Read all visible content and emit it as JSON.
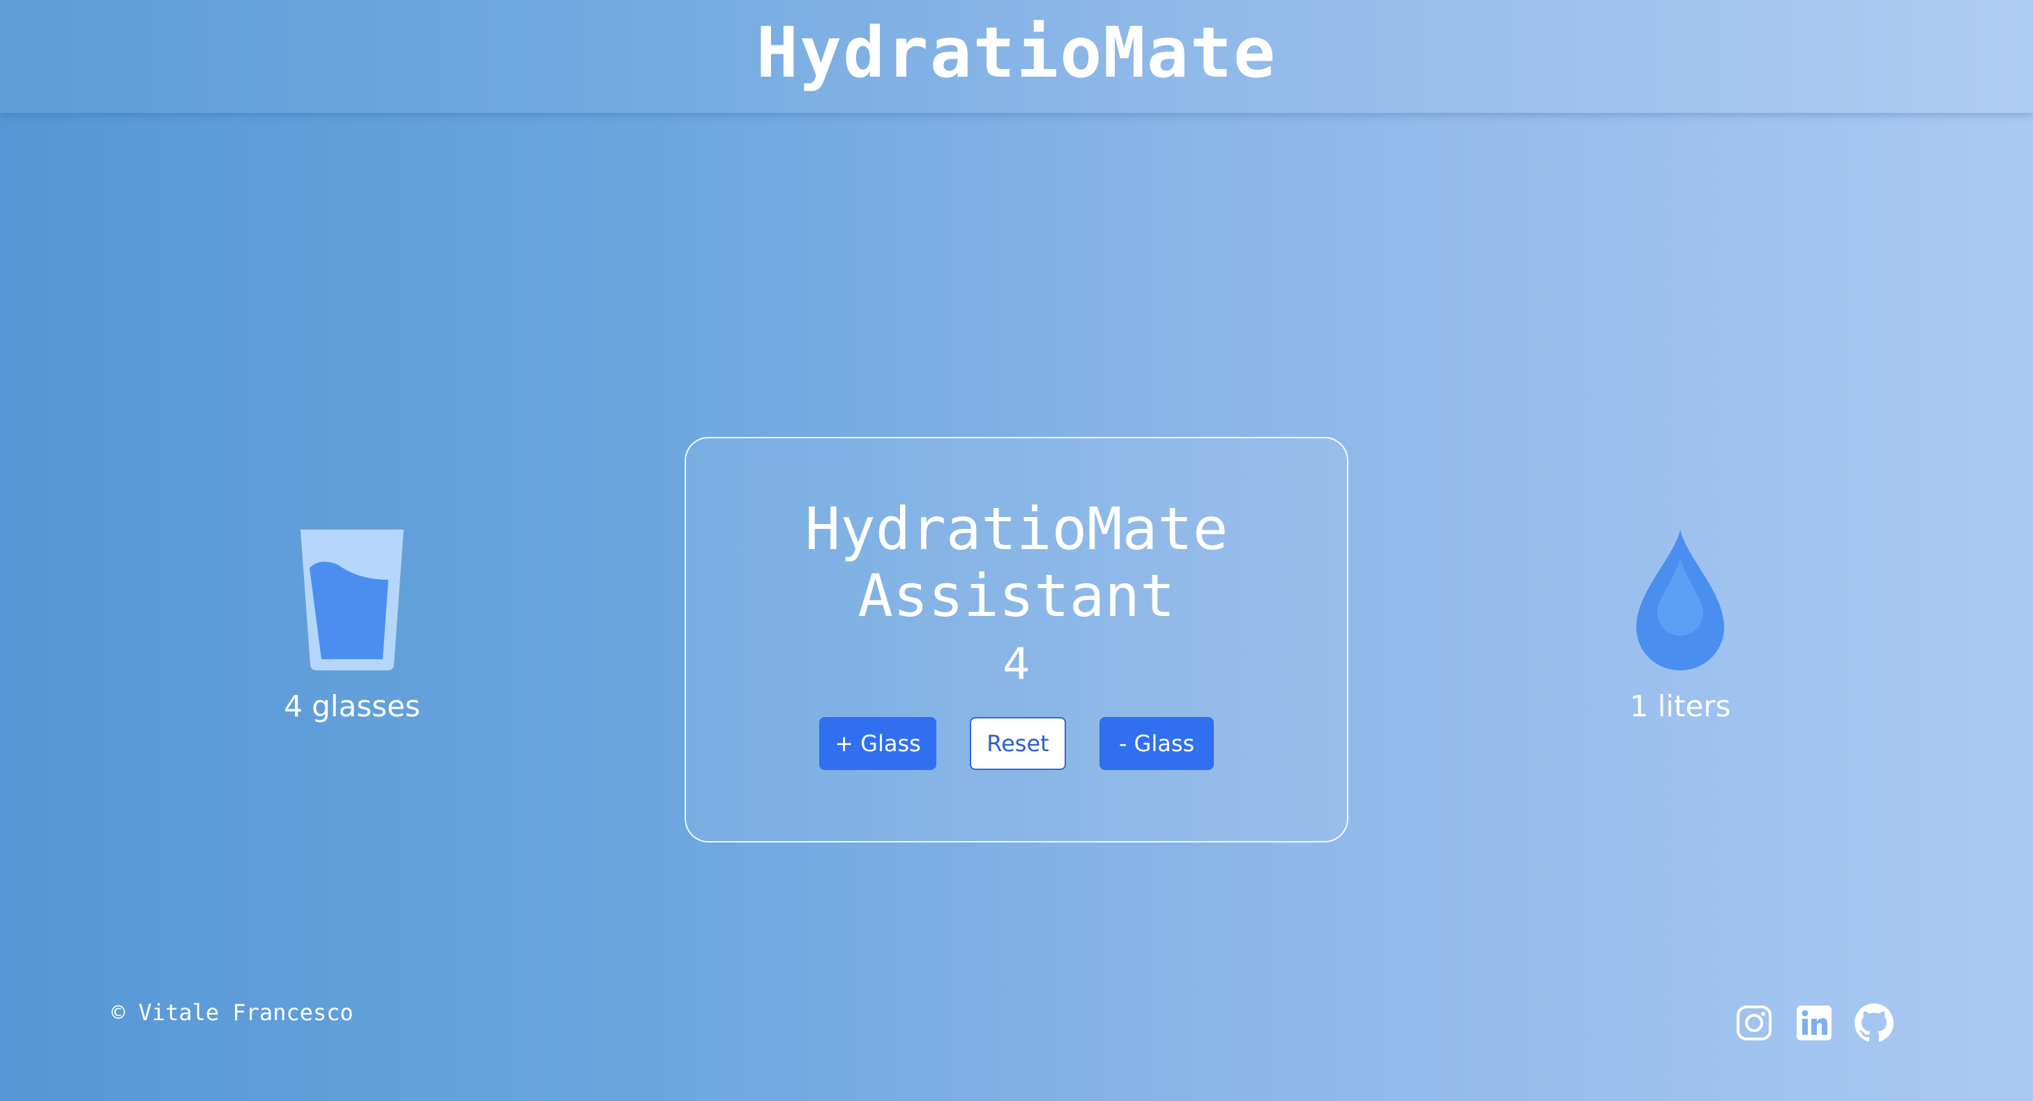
{
  "header": {
    "title": "HydratioMate"
  },
  "card": {
    "title": "HydratioMate Assistant",
    "counter": "4",
    "buttons": {
      "add": "+ Glass",
      "reset": "Reset",
      "remove": "- Glass"
    }
  },
  "left_panel": {
    "icon": "glass-of-water-icon",
    "label": "4 glasses"
  },
  "right_panel": {
    "icon": "water-drop-icon",
    "label": "1 liters"
  },
  "footer": {
    "credit": "© Vitale Francesco",
    "socials": [
      "instagram-icon",
      "linkedin-icon",
      "github-icon"
    ]
  },
  "colors": {
    "primary_button": "#2f6ff0",
    "water": "#4a8ff0",
    "glass": "#b5d6fa"
  }
}
